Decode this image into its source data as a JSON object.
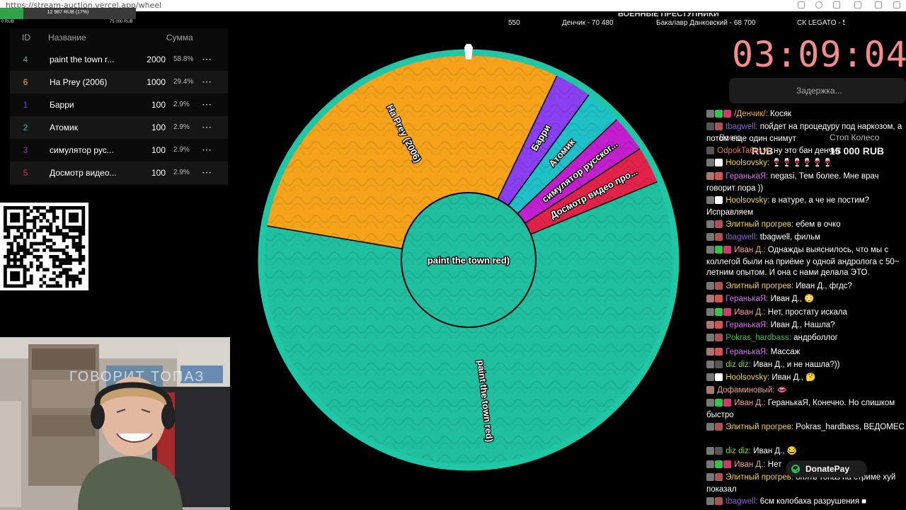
{
  "browser": {
    "url": "https://stream-auction.vercel.app/wheel"
  },
  "progress": {
    "text": "12 987 RUB (17%)",
    "fraction": 0.17,
    "min_label": "0 RUB",
    "max_label": "75 000 RUB"
  },
  "lots_table": {
    "headers": {
      "id": "ID",
      "name": "Название",
      "sum": "Сумма"
    },
    "rows": [
      {
        "id": "4",
        "name": "paint the town r...",
        "sum": "2000",
        "pct": "58.8%",
        "color": "#20b9a0"
      },
      {
        "id": "6",
        "name": "На Prey (2006)",
        "sum": "1000",
        "pct": "29.4%",
        "color": "#f5a623"
      },
      {
        "id": "1",
        "name": "Барри",
        "sum": "100",
        "pct": "2.9%",
        "color": "#7744dd"
      },
      {
        "id": "2",
        "name": "Атомик",
        "sum": "100",
        "pct": "2.9%",
        "color": "#22b8c4"
      },
      {
        "id": "3",
        "name": " симулятор рус...",
        "sum": "100",
        "pct": "2.9%",
        "color": "#b01bb8"
      },
      {
        "id": "5",
        "name": "Досмотр видео...",
        "sum": "100",
        "pct": "2.9%",
        "color": "#e0234a"
      }
    ],
    "more_icon": "⋯"
  },
  "top_bar": {
    "title": "ВОЕННЫЕ ПРЕСТУПНИКИ",
    "ticker": [
      "550",
      "Денчик - 70 480",
      "Бакалавр Данковский - 68 700",
      "СК LEGATO - 5("
    ]
  },
  "wheel": {
    "pointer_color": "#ffffff",
    "center_label": "paint the town red)",
    "segments": [
      {
        "label": "paint the town red)",
        "color": "#1fbfa0",
        "percent": 58.8
      },
      {
        "label": "На Prey (2006)",
        "color": "#f5a31a",
        "percent": 29.4
      },
      {
        "label": "Барри",
        "color": "#8a3ff0",
        "percent": 2.9
      },
      {
        "label": "Атомик",
        "color": "#1fc0c8",
        "percent": 2.9
      },
      {
        "label": "симулятор русског...",
        "color": "#c31fd1",
        "percent": 2.9
      },
      {
        "label": "Досмотр видео про...",
        "color": "#e32249",
        "percent": 2.9
      }
    ]
  },
  "timer": {
    "value": "03:09:04",
    "delay_label": "Задержка..."
  },
  "behind_labels": {
    "total_label": "Всего",
    "wheel_label": "Стоп Колесо",
    "total_value": "RUB",
    "wheel_value": "15 000 RUB"
  },
  "chat": [
    {
      "user": "/Денчик/:",
      "text": "Косяк",
      "color": "#f5b342",
      "b": [
        "#777",
        "#38c14f",
        "#cc3b6b"
      ]
    },
    {
      "user": "tbagwell:",
      "text": "пойдет на процедуру под наркозом, а потом еще один снимут",
      "color": "#8a63d2",
      "b": [
        "#555",
        "#a55"
      ]
    },
    {
      "user": "OdpokTa6ekyt:",
      "text": "ну это бан денчик",
      "color": "#e07b5b",
      "b": [
        "#555"
      ]
    },
    {
      "user": "Hoolsovsky:",
      "text": "🍷🍷🍷🍷🍷🍷",
      "color": "#f5d442",
      "b": [
        "#777",
        "#fff"
      ]
    },
    {
      "user": "ГеранькаЯ:",
      "text": "negasi, Тем более. Мне врач говорит пора ))",
      "color": "#d86ef0",
      "b": [
        "#a77",
        "#c55"
      ]
    },
    {
      "user": "Hoolsovsky:",
      "text": "в натуре, а че не постим? Исправляем",
      "color": "#f5d442",
      "b": [
        "#777",
        "#fff"
      ]
    },
    {
      "user": "Элитный прогрев:",
      "text": "ебем в очко",
      "color": "#f5d442",
      "b": [
        "#777",
        "#a55"
      ]
    },
    {
      "user": "tbagwell:",
      "text": "tbagwell, фильм",
      "color": "#8a63d2",
      "b": [
        "#777",
        "#a55"
      ]
    },
    {
      "user": "Иван Д.:",
      "text": "Однажды выяснилось, что мы с коллегой были на приёме у одной андролога с 50~ летним опытом. И она с нами делала ЭТО.",
      "color": "#f0a0a0",
      "b": [
        "#777",
        "#38c14f",
        "#cc3b6b"
      ]
    },
    {
      "user": "Элитный прогрев:",
      "text": "Иван Д., фгдс?",
      "color": "#f5d442",
      "b": [
        "#777",
        "#a55"
      ]
    },
    {
      "user": "ГеранькаЯ:",
      "text": "Иван Д., 😳",
      "color": "#d86ef0",
      "b": [
        "#a77",
        "#c55"
      ]
    },
    {
      "user": "Иван Д.:",
      "text": "Нет, простату искала",
      "color": "#f0a0a0",
      "b": [
        "#777",
        "#38c14f",
        "#cc3b6b"
      ]
    },
    {
      "user": "ГеранькаЯ:",
      "text": "Иван Д., Нашла?",
      "color": "#d86ef0",
      "b": [
        "#a77",
        "#c55"
      ]
    },
    {
      "user": "Pokras_hardbass:",
      "text": "андрболлог",
      "color": "#38c14f",
      "b": [
        "#777",
        "#a55"
      ]
    },
    {
      "user": "ГеранькаЯ:",
      "text": "Массаж",
      "color": "#d86ef0",
      "b": [
        "#a77",
        "#c55"
      ]
    },
    {
      "user": "diz diz:",
      "text": "Иван Д., и не нашла?))",
      "color": "#9acd32",
      "b": [
        "#777",
        "#555"
      ]
    },
    {
      "user": "Hoolsovsky:",
      "text": "Иван Д., 🤔",
      "color": "#f5d442",
      "b": [
        "#777",
        "#fff"
      ]
    },
    {
      "user": "Дофаминовый:",
      "text": "👄",
      "color": "#f0a0a0",
      "b": [
        "#a77"
      ]
    },
    {
      "user": "Иван Д.:",
      "text": "ГеранькаЯ, Конечно. Но слишком быстро",
      "color": "#f0a0a0",
      "b": [
        "#777",
        "#38c14f",
        "#cc3b6b"
      ]
    },
    {
      "user": "Элитный прогрев:",
      "text": "Pokras_hardbass, ВЕДОМЕС",
      "color": "#f5d442",
      "b": [
        "#777",
        "#a55"
      ]
    },
    {
      "user": "diz diz:",
      "text": "Иван Д., 😂",
      "color": "#9acd32",
      "b": [
        "#777",
        "#555"
      ]
    },
    {
      "user": "Иван Д.:",
      "text": "Нет",
      "color": "#f0a0a0",
      "b": [
        "#777",
        "#38c14f",
        "#cc3b6b"
      ]
    },
    {
      "user": "Элитный прогрев:",
      "text": "опять топаз на стриме хуй показал",
      "color": "#f5d442",
      "b": [
        "#777",
        "#a55"
      ]
    },
    {
      "user": "tbagwell:",
      "text": "6см колобаха разрушения ■",
      "color": "#8a63d2",
      "b": [
        "#777",
        "#a55"
      ]
    }
  ],
  "donate": {
    "label": "DonatePay"
  },
  "webcam": {
    "neon_text": "ГОВОРИТ ТОПАЗ"
  }
}
